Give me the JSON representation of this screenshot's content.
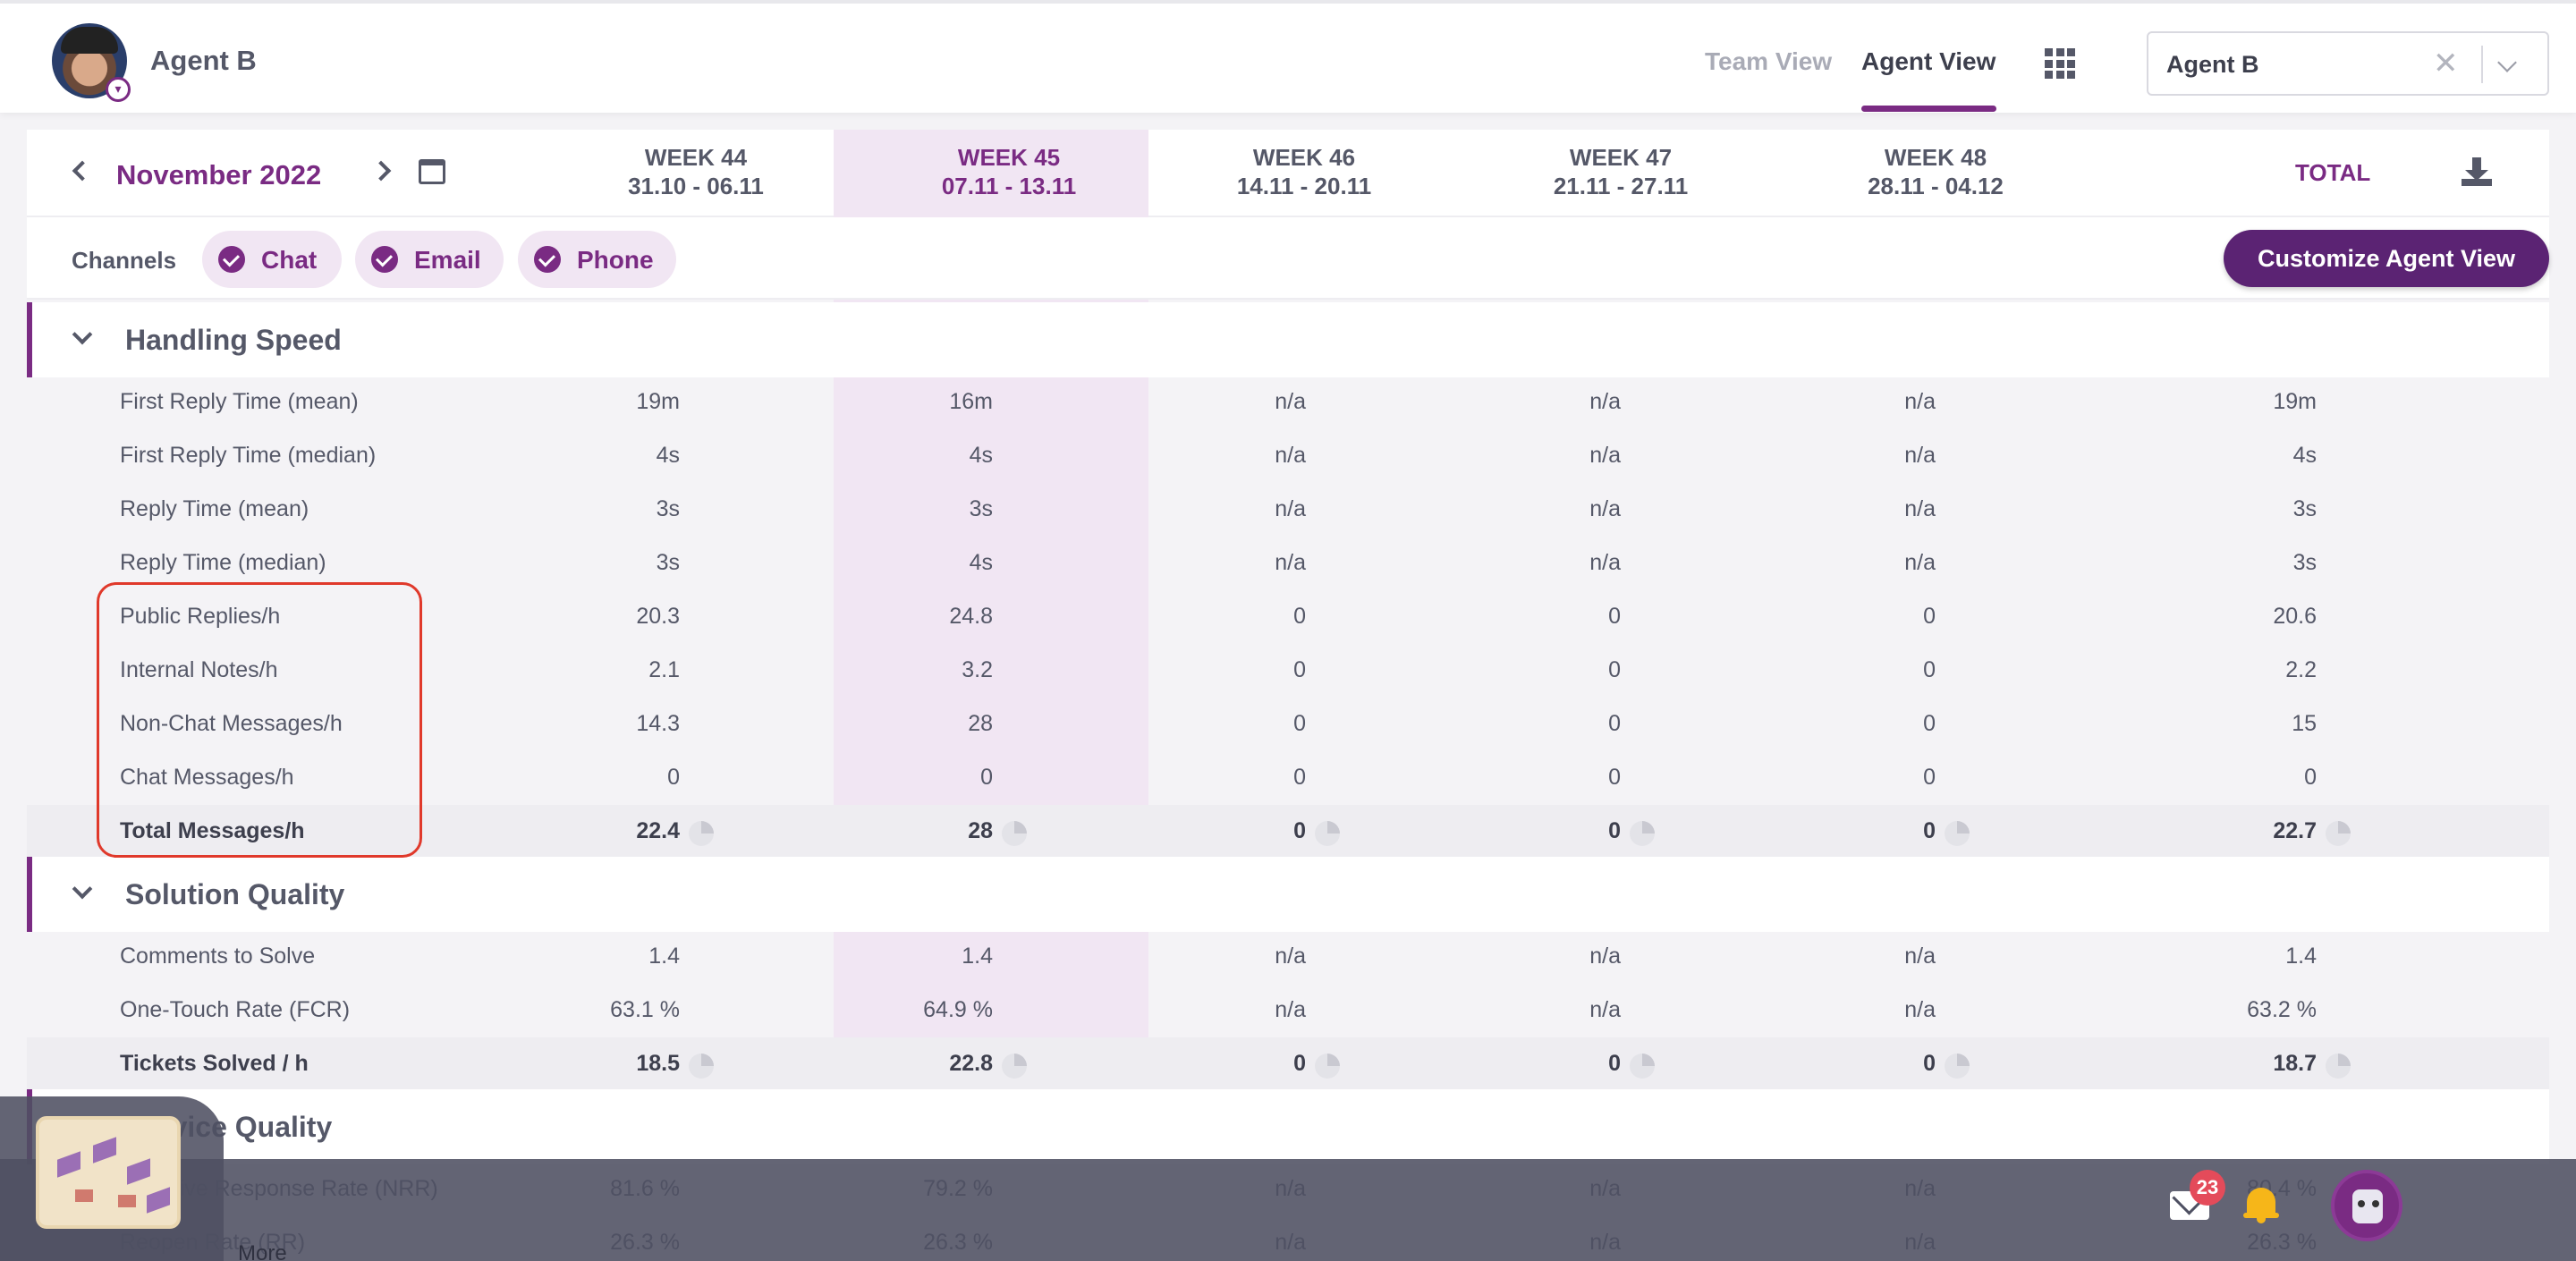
{
  "header": {
    "agent_name": "Agent B",
    "nav": {
      "team_view": "Team View",
      "agent_view": "Agent View"
    },
    "agent_select": {
      "value": "Agent B"
    }
  },
  "period": {
    "month": "November 2022",
    "weeks": [
      {
        "name": "WEEK 44",
        "range": "31.10 - 06.11"
      },
      {
        "name": "WEEK 45",
        "range": "07.11 - 13.11"
      },
      {
        "name": "WEEK 46",
        "range": "14.11 - 20.11"
      },
      {
        "name": "WEEK 47",
        "range": "21.11 - 27.11"
      },
      {
        "name": "WEEK 48",
        "range": "28.11 - 04.12"
      }
    ],
    "total_label": "TOTAL"
  },
  "channels": {
    "label": "Channels",
    "items": [
      "Chat",
      "Email",
      "Phone"
    ],
    "customize_label": "Customize Agent View"
  },
  "sections": {
    "handling_speed": {
      "title": "Handling Speed",
      "rows": [
        {
          "label": "First Reply Time (mean)",
          "values": [
            "19m",
            "16m",
            "n/a",
            "n/a",
            "n/a",
            "19m"
          ]
        },
        {
          "label": "First Reply Time (median)",
          "values": [
            "4s",
            "4s",
            "n/a",
            "n/a",
            "n/a",
            "4s"
          ]
        },
        {
          "label": "Reply Time (mean)",
          "values": [
            "3s",
            "3s",
            "n/a",
            "n/a",
            "n/a",
            "3s"
          ]
        },
        {
          "label": "Reply Time (median)",
          "values": [
            "3s",
            "4s",
            "n/a",
            "n/a",
            "n/a",
            "3s"
          ]
        },
        {
          "label": "Public Replies/h",
          "values": [
            "20.3",
            "24.8",
            "0",
            "0",
            "0",
            "20.6"
          ]
        },
        {
          "label": "Internal Notes/h",
          "values": [
            "2.1",
            "3.2",
            "0",
            "0",
            "0",
            "2.2"
          ]
        },
        {
          "label": "Non-Chat Messages/h",
          "values": [
            "14.3",
            "28",
            "0",
            "0",
            "0",
            "15"
          ]
        },
        {
          "label": "Chat Messages/h",
          "values": [
            "0",
            "0",
            "0",
            "0",
            "0",
            "0"
          ]
        },
        {
          "label": "Total Messages/h",
          "values": [
            "22.4",
            "28",
            "0",
            "0",
            "0",
            "22.7"
          ]
        }
      ]
    },
    "solution_quality": {
      "title": "Solution Quality",
      "rows": [
        {
          "label": "Comments to Solve",
          "values": [
            "1.4",
            "1.4",
            "n/a",
            "n/a",
            "n/a",
            "1.4"
          ]
        },
        {
          "label": "One-Touch Rate (FCR)",
          "values": [
            "63.1 %",
            "64.9 %",
            "n/a",
            "n/a",
            "n/a",
            "63.2 %"
          ]
        },
        {
          "label": "Tickets Solved / h",
          "values": [
            "18.5",
            "22.8",
            "0",
            "0",
            "0",
            "18.7"
          ]
        }
      ]
    },
    "service_quality": {
      "title": "Service Quality",
      "rows": [
        {
          "label": "Negative Response Rate (NRR)",
          "values": [
            "81.6 %",
            "79.2 %",
            "n/a",
            "n/a",
            "n/a",
            "80.4 %"
          ]
        },
        {
          "label": "Reopen Rate (RR)",
          "values": [
            "26.3 %",
            "26.3 %",
            "n/a",
            "n/a",
            "n/a",
            "26.3 %"
          ]
        }
      ]
    }
  },
  "footer": {
    "more_label": "More",
    "mail_badge": "23"
  }
}
